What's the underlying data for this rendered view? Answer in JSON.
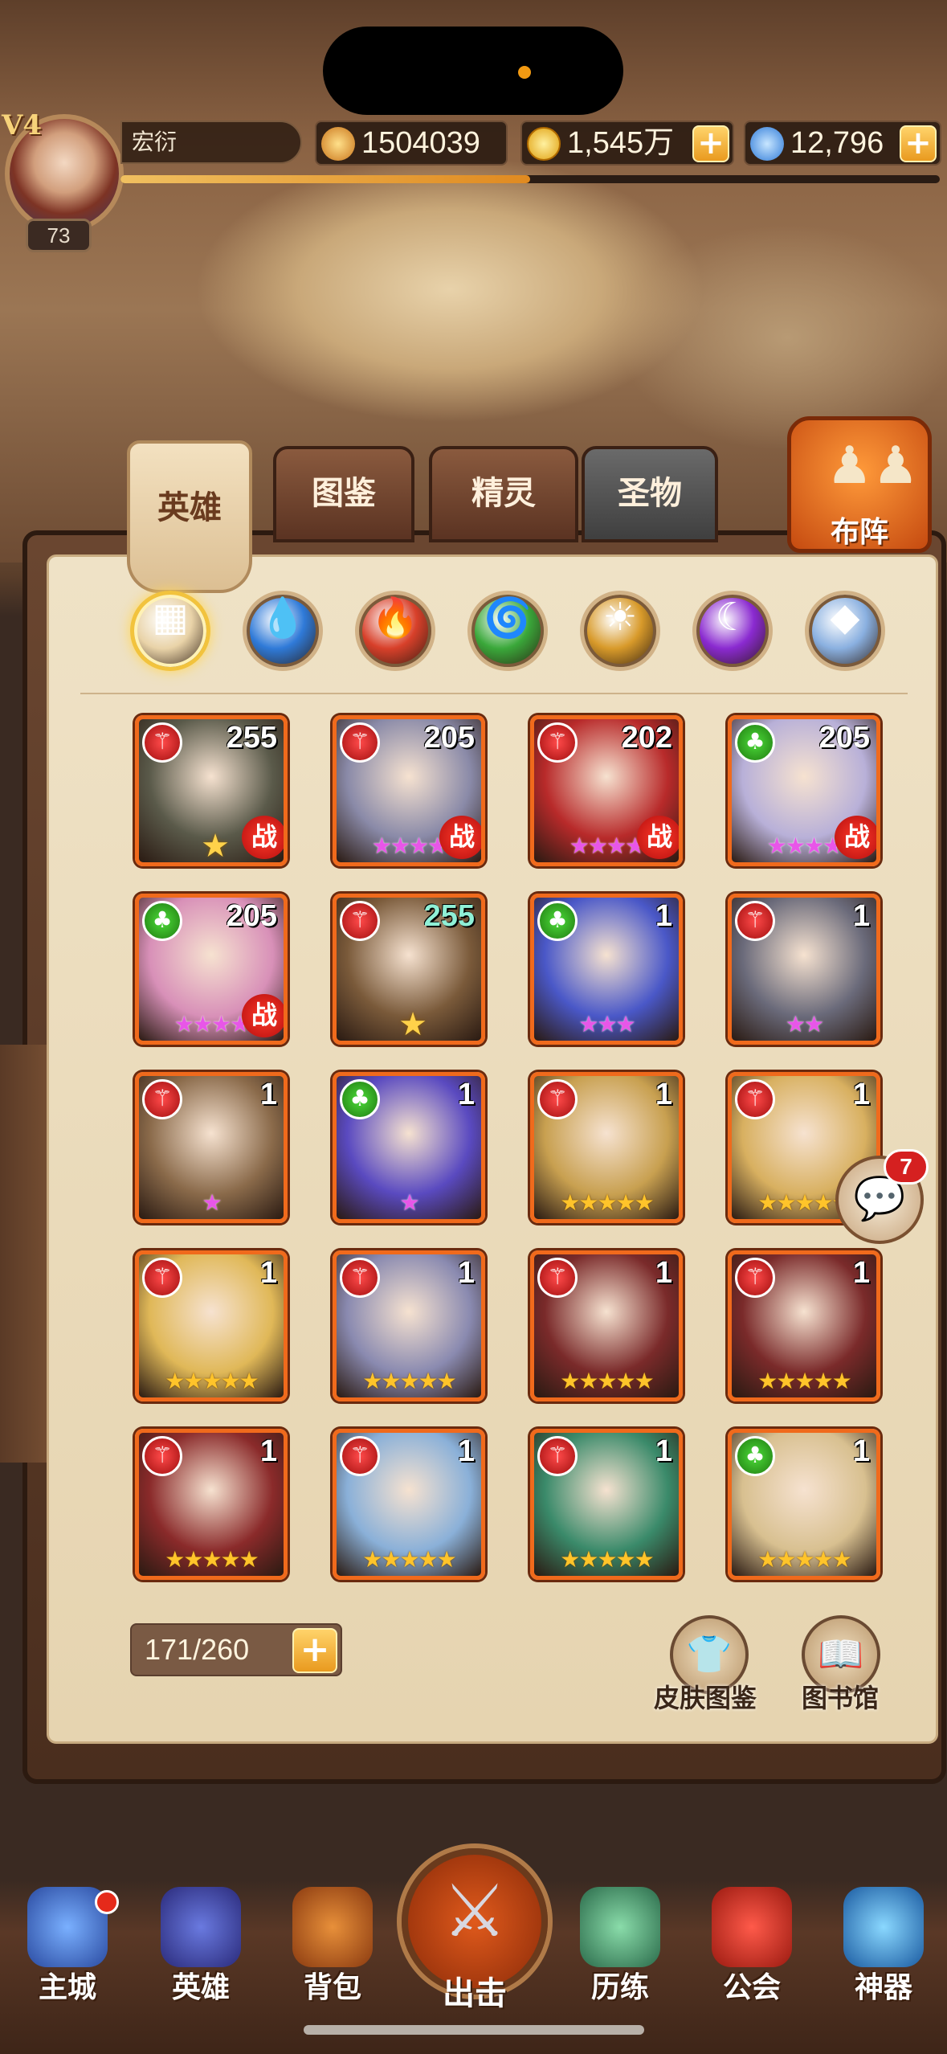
{
  "player": {
    "vip": "V4",
    "level": "73",
    "name": "宏衍",
    "power": "1504039",
    "gold": "1,545万",
    "diamonds": "12,796",
    "exp_fraction": 0.5
  },
  "tabs": [
    "英雄",
    "图鉴",
    "精灵",
    "圣物"
  ],
  "formation_label": "布阵",
  "elements": [
    {
      "name": "all",
      "glyph": "▦",
      "color": "#e9d3a8"
    },
    {
      "name": "water",
      "glyph": "💧",
      "color": "#2f7ad8"
    },
    {
      "name": "fire",
      "glyph": "🔥",
      "color": "#d8402a"
    },
    {
      "name": "wind",
      "glyph": "🌀",
      "color": "#3aa83a"
    },
    {
      "name": "light",
      "glyph": "☀",
      "color": "#d89a2a"
    },
    {
      "name": "dark",
      "glyph": "☾",
      "color": "#8a2ad0"
    },
    {
      "name": "void",
      "glyph": "◆",
      "color": "#8ab0e0"
    }
  ],
  "heroes": [
    {
      "level": "255",
      "badge": "red",
      "war": true,
      "stars": "",
      "crest": true,
      "bg": "#5a5a4a"
    },
    {
      "level": "205",
      "badge": "red",
      "war": true,
      "stars": "★★★★",
      "star_color": "pink",
      "bg": "#8a8aa8"
    },
    {
      "level": "202",
      "badge": "red",
      "war": true,
      "stars": "★★★★",
      "star_color": "pink",
      "bg": "#b82a2a"
    },
    {
      "level": "205",
      "badge": "green",
      "war": true,
      "stars": "★★★★",
      "star_color": "pink",
      "bg": "#b8b0d8"
    },
    {
      "level": "205",
      "badge": "green",
      "war": true,
      "stars": "★★★★",
      "star_color": "pink",
      "bg": "#d890b8"
    },
    {
      "level": "255",
      "badge": "red",
      "war": false,
      "stars": "",
      "crest": true,
      "teal": true,
      "bg": "#7a5a3a"
    },
    {
      "level": "1",
      "badge": "green",
      "war": false,
      "stars": "★★★",
      "star_color": "pink",
      "bg": "#4a58c8"
    },
    {
      "level": "1",
      "badge": "red",
      "war": false,
      "stars": "★★",
      "star_color": "pink",
      "bg": "#6a6a7a"
    },
    {
      "level": "1",
      "badge": "red",
      "war": false,
      "stars": "★",
      "star_color": "pink",
      "bg": "#8a6a4a"
    },
    {
      "level": "1",
      "badge": "green",
      "war": false,
      "stars": "★",
      "star_color": "pink",
      "bg": "#5a4ac0"
    },
    {
      "level": "1",
      "badge": "red",
      "war": false,
      "stars": "★★★★★",
      "star_color": "gold",
      "bg": "#c8a050"
    },
    {
      "level": "1",
      "badge": "red",
      "war": false,
      "stars": "★★★★★",
      "star_color": "gold",
      "bg": "#d8b060"
    },
    {
      "level": "1",
      "badge": "red",
      "war": false,
      "stars": "★★★★★",
      "star_color": "gold",
      "bg": "#e0b858"
    },
    {
      "level": "1",
      "badge": "red",
      "war": false,
      "stars": "★★★★★",
      "star_color": "gold",
      "bg": "#8a8ab0"
    },
    {
      "level": "1",
      "badge": "red",
      "war": false,
      "stars": "★★★★★",
      "star_color": "gold",
      "bg": "#7a2a2a"
    },
    {
      "level": "1",
      "badge": "red",
      "war": false,
      "stars": "★★★★★",
      "star_color": "gold",
      "bg": "#7a2a2a"
    },
    {
      "level": "1",
      "badge": "red",
      "war": false,
      "stars": "★★★★★",
      "star_color": "gold",
      "bg": "#8a2a2a"
    },
    {
      "level": "1",
      "badge": "red",
      "war": false,
      "stars": "★★★★★",
      "star_color": "gold",
      "bg": "#8ab0d8"
    },
    {
      "level": "1",
      "badge": "red",
      "war": false,
      "stars": "★★★★★",
      "star_color": "gold",
      "bg": "#3a8a6a"
    },
    {
      "level": "1",
      "badge": "green",
      "war": false,
      "stars": "★★★★★",
      "star_color": "gold",
      "bg": "#d8c090"
    }
  ],
  "war_label": "战",
  "hero_count": "171/260",
  "skin_collection_label": "皮肤图鉴",
  "library_label": "图书馆",
  "chat_unread": "7",
  "nav": {
    "main_city": "主城",
    "heroes": "英雄",
    "backpack": "背包",
    "attack": "出击",
    "training": "历练",
    "guild": "公会",
    "artifact": "神器"
  },
  "colors": {
    "card_border": "#f06a1c",
    "accent_gold": "#f2c33d",
    "paper": "#efe2c6"
  }
}
